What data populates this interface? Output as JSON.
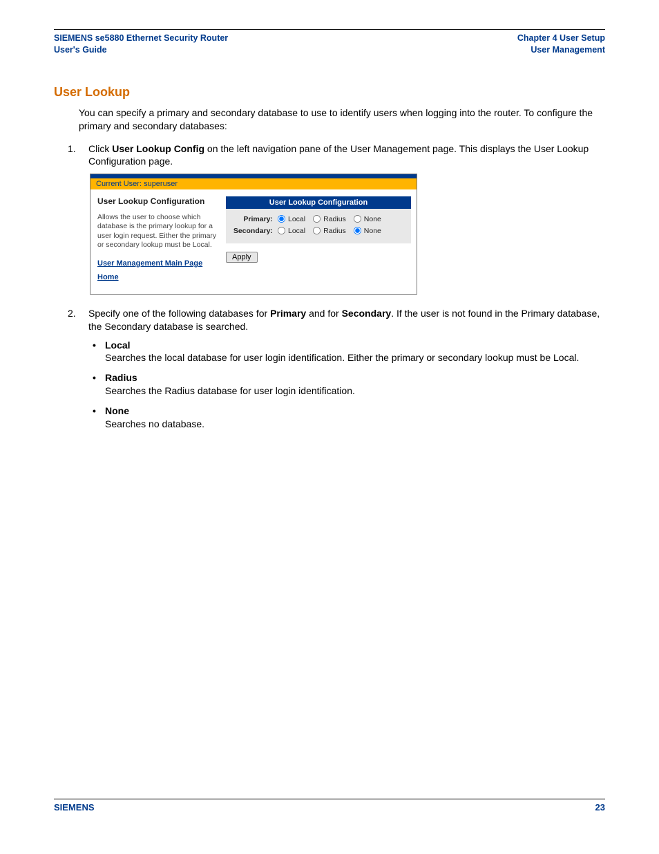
{
  "header": {
    "left_line1": "SIEMENS se5880 Ethernet Security Router",
    "left_line2": "User's Guide",
    "right_line1": "Chapter 4  User Setup",
    "right_line2": "User Management"
  },
  "section_title": "User Lookup",
  "intro": "You can specify a primary and secondary database to use to identify users when logging into the router. To configure the primary and secondary databases:",
  "step1": {
    "num": "1.",
    "pre": "Click ",
    "bold": "User Lookup Config",
    "post": " on the left navigation pane of the User Management page. This displays the User Lookup Configuration page."
  },
  "screenshot": {
    "current_user_label": "Current User: superuser",
    "left_title": "User Lookup Configuration",
    "left_desc": "Allows the user to choose which database is the primary lookup for a user login request. Either the primary or secondary lookup must be Local.",
    "link1": "User Management Main Page",
    "link2": "Home",
    "panel_title": "User Lookup Configuration",
    "row_primary_label": "Primary:",
    "row_secondary_label": "Secondary:",
    "opt_local": "Local",
    "opt_radius": "Radius",
    "opt_none": "None",
    "apply": "Apply"
  },
  "step2": {
    "num": "2.",
    "pre": "Specify one of the following databases for ",
    "b1": "Primary",
    "mid": " and for ",
    "b2": "Secondary",
    "post": ". If the user is not found in the Primary database, the Secondary database is searched."
  },
  "bullets": {
    "dot": "•",
    "local_t": "Local",
    "local_d": "Searches the local database for user login identification. Either the primary or secondary lookup must be Local.",
    "radius_t": "Radius",
    "radius_d": "Searches the Radius database for user login identification.",
    "none_t": "None",
    "none_d": "Searches no database."
  },
  "footer": {
    "brand": "SIEMENS",
    "page": "23"
  }
}
